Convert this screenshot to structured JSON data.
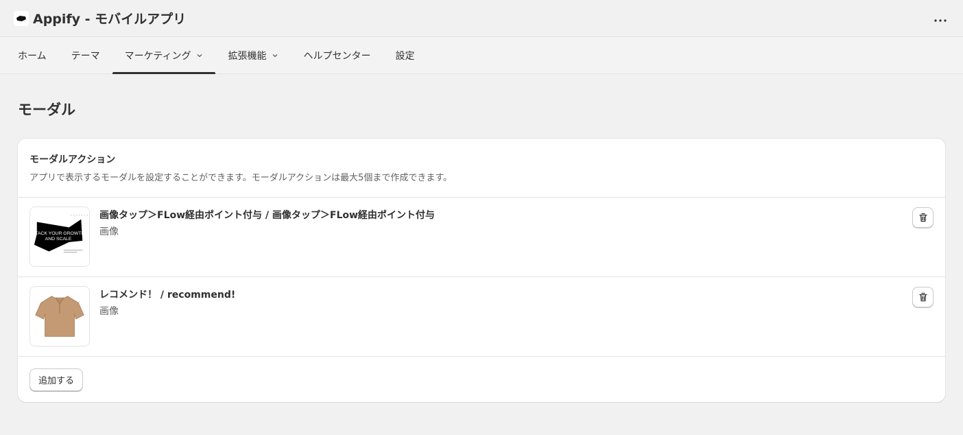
{
  "app": {
    "title": "Appify - モバイルアプリ"
  },
  "nav": {
    "items": [
      {
        "label": "ホーム",
        "dropdown": false,
        "active": false
      },
      {
        "label": "テーマ",
        "dropdown": false,
        "active": false
      },
      {
        "label": "マーケティング",
        "dropdown": true,
        "active": true
      },
      {
        "label": "拡張機能",
        "dropdown": true,
        "active": false
      },
      {
        "label": "ヘルプセンター",
        "dropdown": false,
        "active": false
      },
      {
        "label": "設定",
        "dropdown": false,
        "active": false
      }
    ]
  },
  "page": {
    "title": "モーダル"
  },
  "card": {
    "title": "モーダルアクション",
    "description": "アプリで表示するモーダルを設定することができます。モーダルアクションは最大5個まで作成できます。",
    "rows": [
      {
        "title": "画像タップ＞FLow経由ポイント付与 / 画像タップ＞FLow経由ポイント付与",
        "subtitle": "画像",
        "thumb_line1": "STACK YOUR GROWTH",
        "thumb_line2": "AND SCALE"
      },
      {
        "title": "レコメンド！ / recommend!",
        "subtitle": "画像"
      }
    ],
    "add_label": "追加する"
  },
  "colors": {
    "background": "#f1f1f1",
    "text": "#303030",
    "subdued": "#616161",
    "border": "#e3e3e3"
  }
}
